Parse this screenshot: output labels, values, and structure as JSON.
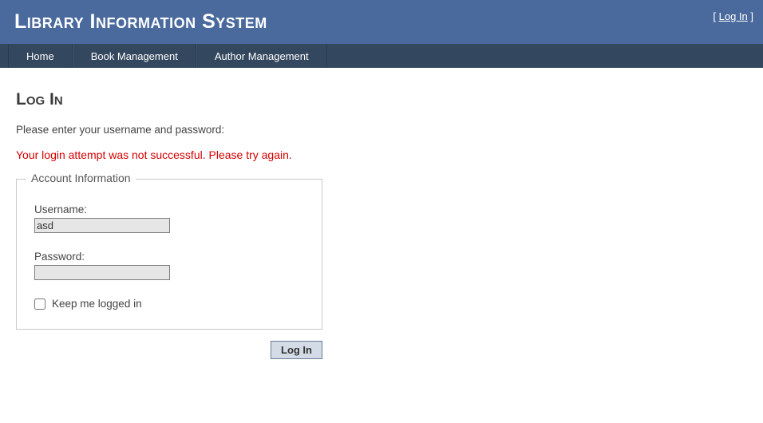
{
  "header": {
    "site_title": "Library Information System",
    "login_link": "Log In"
  },
  "nav": {
    "items": [
      {
        "label": "Home"
      },
      {
        "label": "Book Management"
      },
      {
        "label": "Author Management"
      }
    ]
  },
  "page": {
    "heading": "Log In",
    "instruction": "Please enter your username and password:",
    "error": "Your login attempt was not successful. Please try again."
  },
  "form": {
    "legend": "Account Information",
    "username_label": "Username:",
    "username_value": "asd",
    "password_label": "Password:",
    "password_value": "",
    "remember_label": "Keep me logged in",
    "submit_label": "Log In"
  }
}
